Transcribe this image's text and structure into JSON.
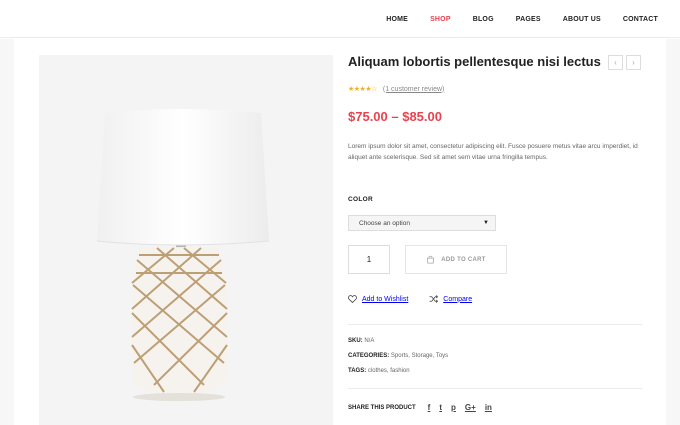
{
  "nav": {
    "items": [
      {
        "label": "HOME",
        "active": false
      },
      {
        "label": "SHOP",
        "active": true
      },
      {
        "label": "BLOG",
        "active": false
      },
      {
        "label": "PAGES",
        "active": false
      },
      {
        "label": "ABOUT US",
        "active": false
      },
      {
        "label": "CONTACT",
        "active": false
      }
    ]
  },
  "product": {
    "title": "Aliquam lobortis pellentesque nisi lectus",
    "rating_stars": "★★★★☆",
    "rating_value": 4,
    "review_text": "(1 customer review)",
    "price": "$75.00 – $85.00",
    "description": "Lorem ipsum dolor sit amet, consectetur adipiscing elit. Fusce posuere metus vitae arcu imperdiet, id aliquet ante scelerisque. Sed sit amet sem vitae urna fringilla tempus.",
    "color_label": "COLOR",
    "color_select": "Choose an option",
    "quantity": "1",
    "add_to_cart": "ADD TO CART",
    "wishlist": "Add to Wishlist",
    "compare": "Compare",
    "sku_label": "SKU:",
    "sku_value": "N/A",
    "categories_label": "CATEGORIES:",
    "categories_value": "Sports, Storage, Toys",
    "tags_label": "TAGS:",
    "tags_value": "clothes, fashion",
    "share_label": "SHARE THIS PRODUCT"
  },
  "icons": {
    "prev": "‹",
    "next": "›",
    "select_arrow": "▼",
    "facebook": "f",
    "twitter": "t",
    "pinterest": "p",
    "googleplus": "G+",
    "linkedin": "in"
  },
  "colors": {
    "accent": "#e8424e",
    "star": "#f2b01e"
  }
}
